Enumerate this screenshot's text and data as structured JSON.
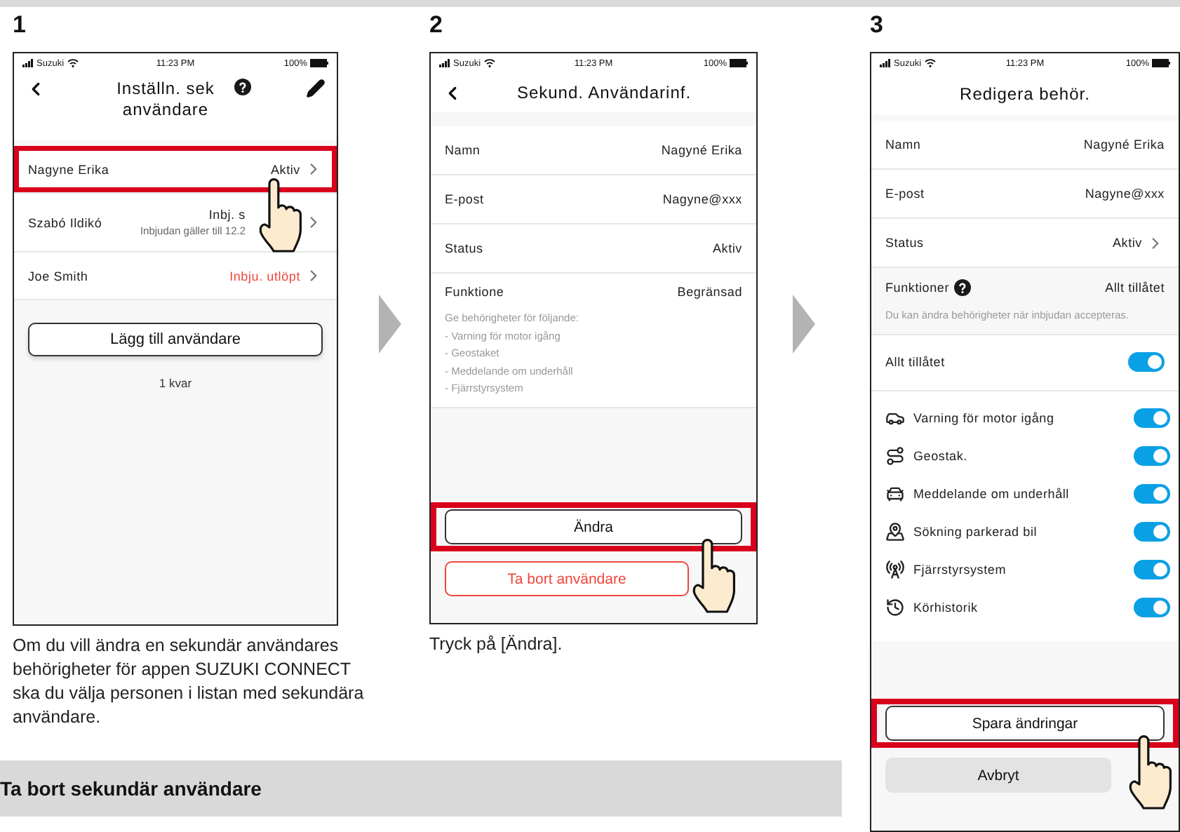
{
  "steps": [
    {
      "number": "1",
      "screen": {
        "kind": "user_list",
        "status_bar": {
          "carrier": "Suzuki",
          "time": "11:23 PM",
          "battery": "100%"
        },
        "title": "Inställn. sek användare",
        "users": [
          {
            "name": "Nagyne Erika",
            "status": "Aktiv",
            "expired": false,
            "highlighted": true,
            "tapped": true
          },
          {
            "name": "Szabó Ildikó",
            "status": "Inbj. s",
            "note": "Inbjudan gäller till 12.2",
            "expired": false,
            "highlighted": false,
            "tapped": false
          },
          {
            "name": "Joe Smith",
            "status": "Inbju. utlöpt",
            "expired": true,
            "highlighted": false,
            "tapped": false
          }
        ],
        "add_button": "Lägg till användare",
        "remaining": "1 kvar"
      },
      "caption": "Om du vill ändra en sekundär användares behörigheter för appen SUZUKI CONNECT ska du välja personen i listan med sekundära användare."
    },
    {
      "number": "2",
      "screen": {
        "kind": "user_info",
        "status_bar": {
          "carrier": "Suzuki",
          "time": "11:23 PM",
          "battery": "100%"
        },
        "title": "Sekund. Användarinf.",
        "fields": [
          {
            "label": "Namn",
            "value": "Nagyné Erika"
          },
          {
            "label": "E-post",
            "value": "Nagyne@xxx"
          },
          {
            "label": "Status",
            "value": "Aktiv"
          },
          {
            "label": "Funktione",
            "value": "Begränsad"
          }
        ],
        "note": "Ge behörigheter för följande:",
        "note_items": [
          "- Varning för motor igång",
          "- Geostaket",
          "- Meddelande om underhåll",
          "- Fjärrstyrsystem"
        ],
        "buttons": [
          {
            "label": "Ändra",
            "kind": "outline",
            "highlighted": true,
            "tapped": true
          },
          {
            "label": "Ta bort användare",
            "kind": "danger",
            "highlighted": false,
            "tapped": false
          }
        ]
      },
      "caption": "Tryck på [Ändra]."
    },
    {
      "number": "3",
      "screen": {
        "kind": "edit_permissions",
        "status_bar": {
          "carrier": "Suzuki",
          "time": "11:23 PM",
          "battery": "100%"
        },
        "title": "Redigera behör.",
        "fields": [
          {
            "label": "Namn",
            "value": "Nagyné Erika",
            "link": false
          },
          {
            "label": "E-post",
            "value": "Nagyne@xxx",
            "link": false
          },
          {
            "label": "Status",
            "value": "Aktiv",
            "link": true
          }
        ],
        "functions": {
          "label": "Funktioner",
          "value": "Allt tillåtet",
          "note": "Du kan ändra behörigheter när inbjudan accepteras."
        },
        "all_toggle": {
          "label": "Allt tillåtet",
          "on": true
        },
        "features": [
          {
            "label": "Varning för motor igång",
            "kind": "engine",
            "on": true
          },
          {
            "label": "Geostak.",
            "kind": "geofence",
            "on": true
          },
          {
            "label": "Meddelande om underhåll",
            "kind": "maintenance",
            "on": true
          },
          {
            "label": "Sökning parkerad bil",
            "kind": "parking",
            "on": true
          },
          {
            "label": "Fjärrstyrsystem",
            "kind": "remote",
            "on": true
          },
          {
            "label": "Körhistorik",
            "kind": "history",
            "on": true
          }
        ],
        "buttons": [
          {
            "label": "Spara ändringar",
            "kind": "outline",
            "highlighted": true,
            "tapped": true
          },
          {
            "label": "Avbryt",
            "kind": "muted",
            "highlighted": false,
            "tapped": false
          }
        ]
      }
    }
  ],
  "section_heading": "Ta bort sekundär användare"
}
